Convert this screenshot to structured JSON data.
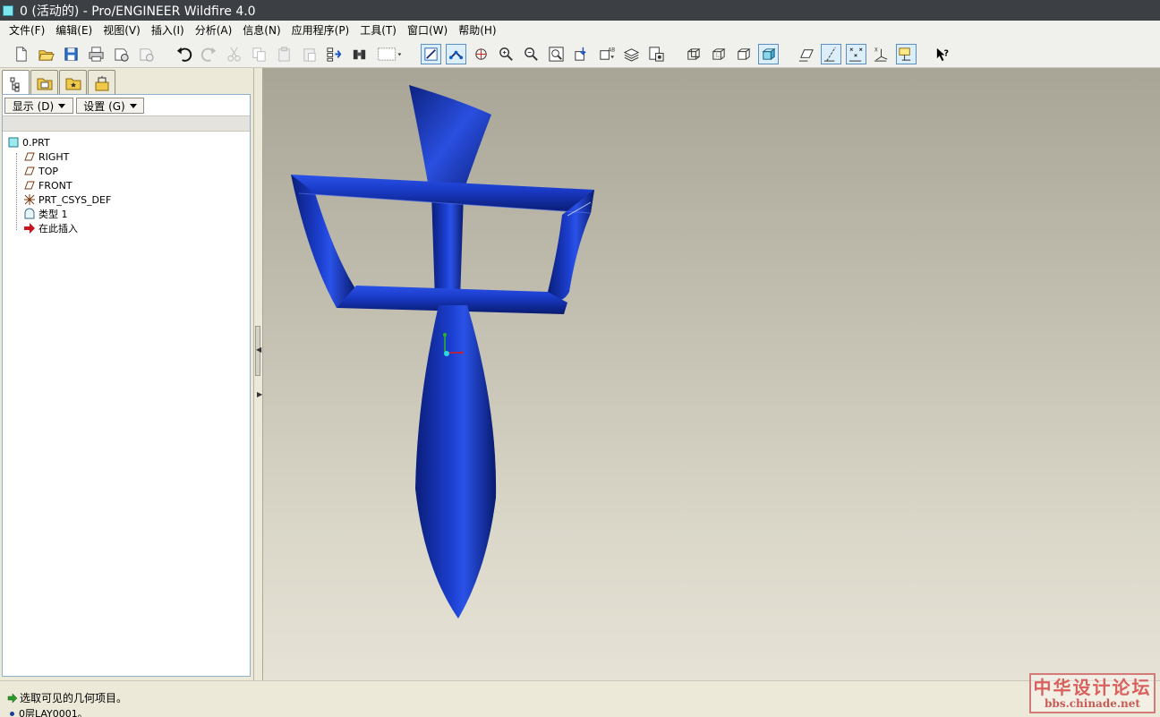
{
  "window": {
    "title": "0 (活动的) - Pro/ENGINEER Wildfire 4.0"
  },
  "menu": [
    {
      "label": "文件(F)"
    },
    {
      "label": "编辑(E)"
    },
    {
      "label": "视图(V)"
    },
    {
      "label": "插入(I)"
    },
    {
      "label": "分析(A)"
    },
    {
      "label": "信息(N)"
    },
    {
      "label": "应用程序(P)"
    },
    {
      "label": "工具(T)"
    },
    {
      "label": "窗口(W)"
    },
    {
      "label": "帮助(H)"
    }
  ],
  "toolbar_icons": [
    "new-file-icon",
    "open-folder-icon",
    "save-icon",
    "print-icon",
    "send-mail-icon",
    "mail-icon",
    "undo-icon",
    "redo-icon",
    "cut-icon",
    "copy-icon",
    "paste-icon",
    "paste-special-icon",
    "regenerate-icon",
    "find-icon",
    "select-box-icon",
    "sketch-view-icon",
    "datum-display-icon",
    "spin-center-icon",
    "zoom-in-icon",
    "zoom-out-icon",
    "refit-icon",
    "orient-icon",
    "saved-views-icon",
    "layers-icon",
    "view-manager-icon",
    "wireframe-icon",
    "hidden-line-icon",
    "no-hidden-icon",
    "shading-icon",
    "datum-planes-icon",
    "datum-axes-icon",
    "datum-points-icon",
    "coordinate-systems-icon",
    "annotation-icon",
    "context-help-icon"
  ],
  "panel": {
    "show_label": "显示 (D)",
    "settings_label": "设置 (G)",
    "tree": [
      {
        "label": "0.PRT",
        "icon": "part-icon"
      },
      {
        "label": "RIGHT",
        "icon": "datum-plane-icon"
      },
      {
        "label": "TOP",
        "icon": "datum-plane-icon"
      },
      {
        "label": "FRONT",
        "icon": "datum-plane-icon"
      },
      {
        "label": "PRT_CSYS_DEF",
        "icon": "csys-icon"
      },
      {
        "label": "类型 1",
        "icon": "feature-icon"
      },
      {
        "label": "在此插入",
        "icon": "insert-arrow-icon"
      }
    ]
  },
  "status": {
    "message": "选取可见的几何项目。",
    "layer": "0层LAY0001。"
  },
  "watermark": {
    "cn": "中华设计论坛",
    "en": "bbs.chinade.net"
  },
  "colors": {
    "model_blue": "#0f2a9a",
    "title_bar": "#3c3f44"
  }
}
